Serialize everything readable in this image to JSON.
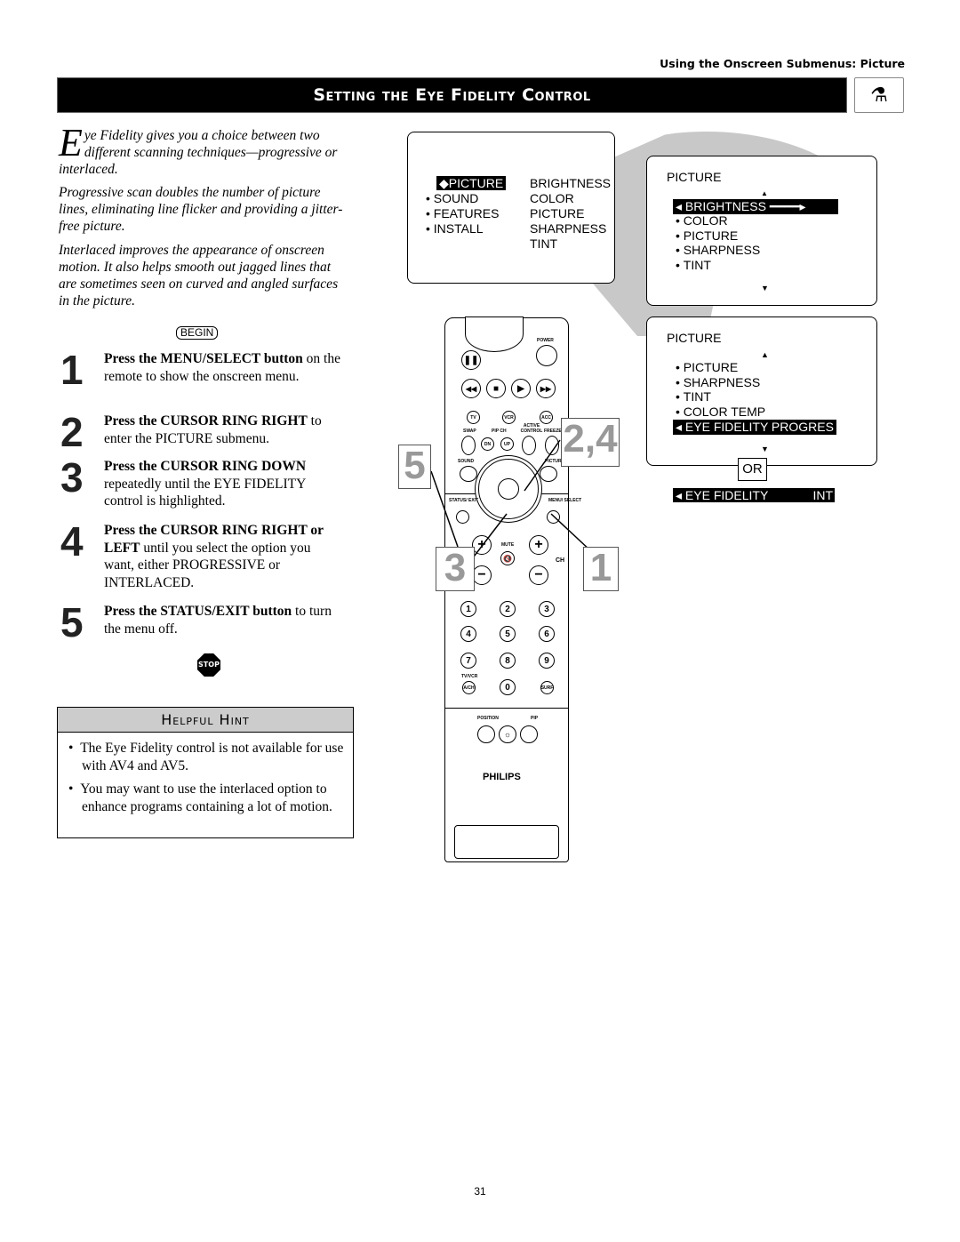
{
  "header": {
    "section": "Using the Onscreen Submenus: Picture",
    "title": "Setting the Eye Fidelity Control"
  },
  "intro": {
    "dropcap": "E",
    "p1": "ye Fidelity gives you a choice between two different scanning techniques—progressive or interlaced.",
    "p2": "Progressive scan doubles the number of picture lines, eliminating line flicker and providing a jitter-free picture.",
    "p3": "Interlaced improves the appearance of onscreen motion. It also helps smooth out jagged lines that are sometimes seen on curved and angled surfaces in the picture."
  },
  "begin_label": "BEGIN",
  "steps": [
    {
      "num": "1",
      "bold": "Press the MENU/SELECT button",
      "text": " on the remote to show the onscreen menu."
    },
    {
      "num": "2",
      "bold": "Press the CURSOR RING RIGHT",
      "text": " to enter the PICTURE submenu."
    },
    {
      "num": "3",
      "bold": "Press the CURSOR RING DOWN",
      "text": " repeatedly until the EYE FIDELITY control is highlighted."
    },
    {
      "num": "4",
      "bold": "Press the CURSOR RING RIGHT or LEFT",
      "text": " until you select the option you want, either PROGRESSIVE or INTERLACED."
    },
    {
      "num": "5",
      "bold": "Press the STATUS/EXIT button",
      "text": " to turn the menu off."
    }
  ],
  "stop_label": "STOP",
  "hint": {
    "title": "Helpful Hint",
    "items": [
      "The Eye Fidelity control is not available for use with AV4 and AV5.",
      "You may want to use the interlaced option to enhance programs containing a lot of motion."
    ]
  },
  "menu_main": {
    "left": [
      "PICTURE",
      "SOUND",
      "FEATURES",
      "INSTALL"
    ],
    "right": [
      "BRIGHTNESS",
      "COLOR",
      "PICTURE",
      "SHARPNESS",
      "TINT"
    ]
  },
  "menu_picture1": {
    "title": "PICTURE",
    "items": [
      "BRIGHTNESS",
      "COLOR",
      "PICTURE",
      "SHARPNESS",
      "TINT"
    ]
  },
  "menu_picture2": {
    "title": "PICTURE",
    "items": [
      "PICTURE",
      "SHARPNESS",
      "TINT",
      "COLOR TEMP"
    ],
    "selected": "EYE FIDELITY",
    "selected_value": "PROGRES"
  },
  "or_label": "OR",
  "alt_option": {
    "label": "EYE FIDELITY",
    "value": "INT"
  },
  "callouts": [
    "5",
    "2,4",
    "3",
    "1"
  ],
  "remote": {
    "power": "POWER",
    "tv": "TV",
    "vcr": "VCR",
    "acc": "ACC",
    "swap": "SWAP",
    "pipch": "PIP CH",
    "dn": "DN",
    "up": "UP",
    "active": "ACTIVE CONTROL",
    "freeze": "FREEZE",
    "sound": "SOUND",
    "picture": "PICTURE",
    "status": "STATUS/ EXIT",
    "menu": "MENU/ SELECT",
    "mute": "MUTE",
    "ch": "CH",
    "digits": [
      "1",
      "2",
      "3",
      "4",
      "5",
      "6",
      "7",
      "8",
      "9",
      "0"
    ],
    "tvvcr": "TV/VCR",
    "ach": "A/CH",
    "surf": "SURF",
    "position": "POSITION",
    "pip": "PIP",
    "brand": "PHILIPS"
  },
  "page_number": "31"
}
